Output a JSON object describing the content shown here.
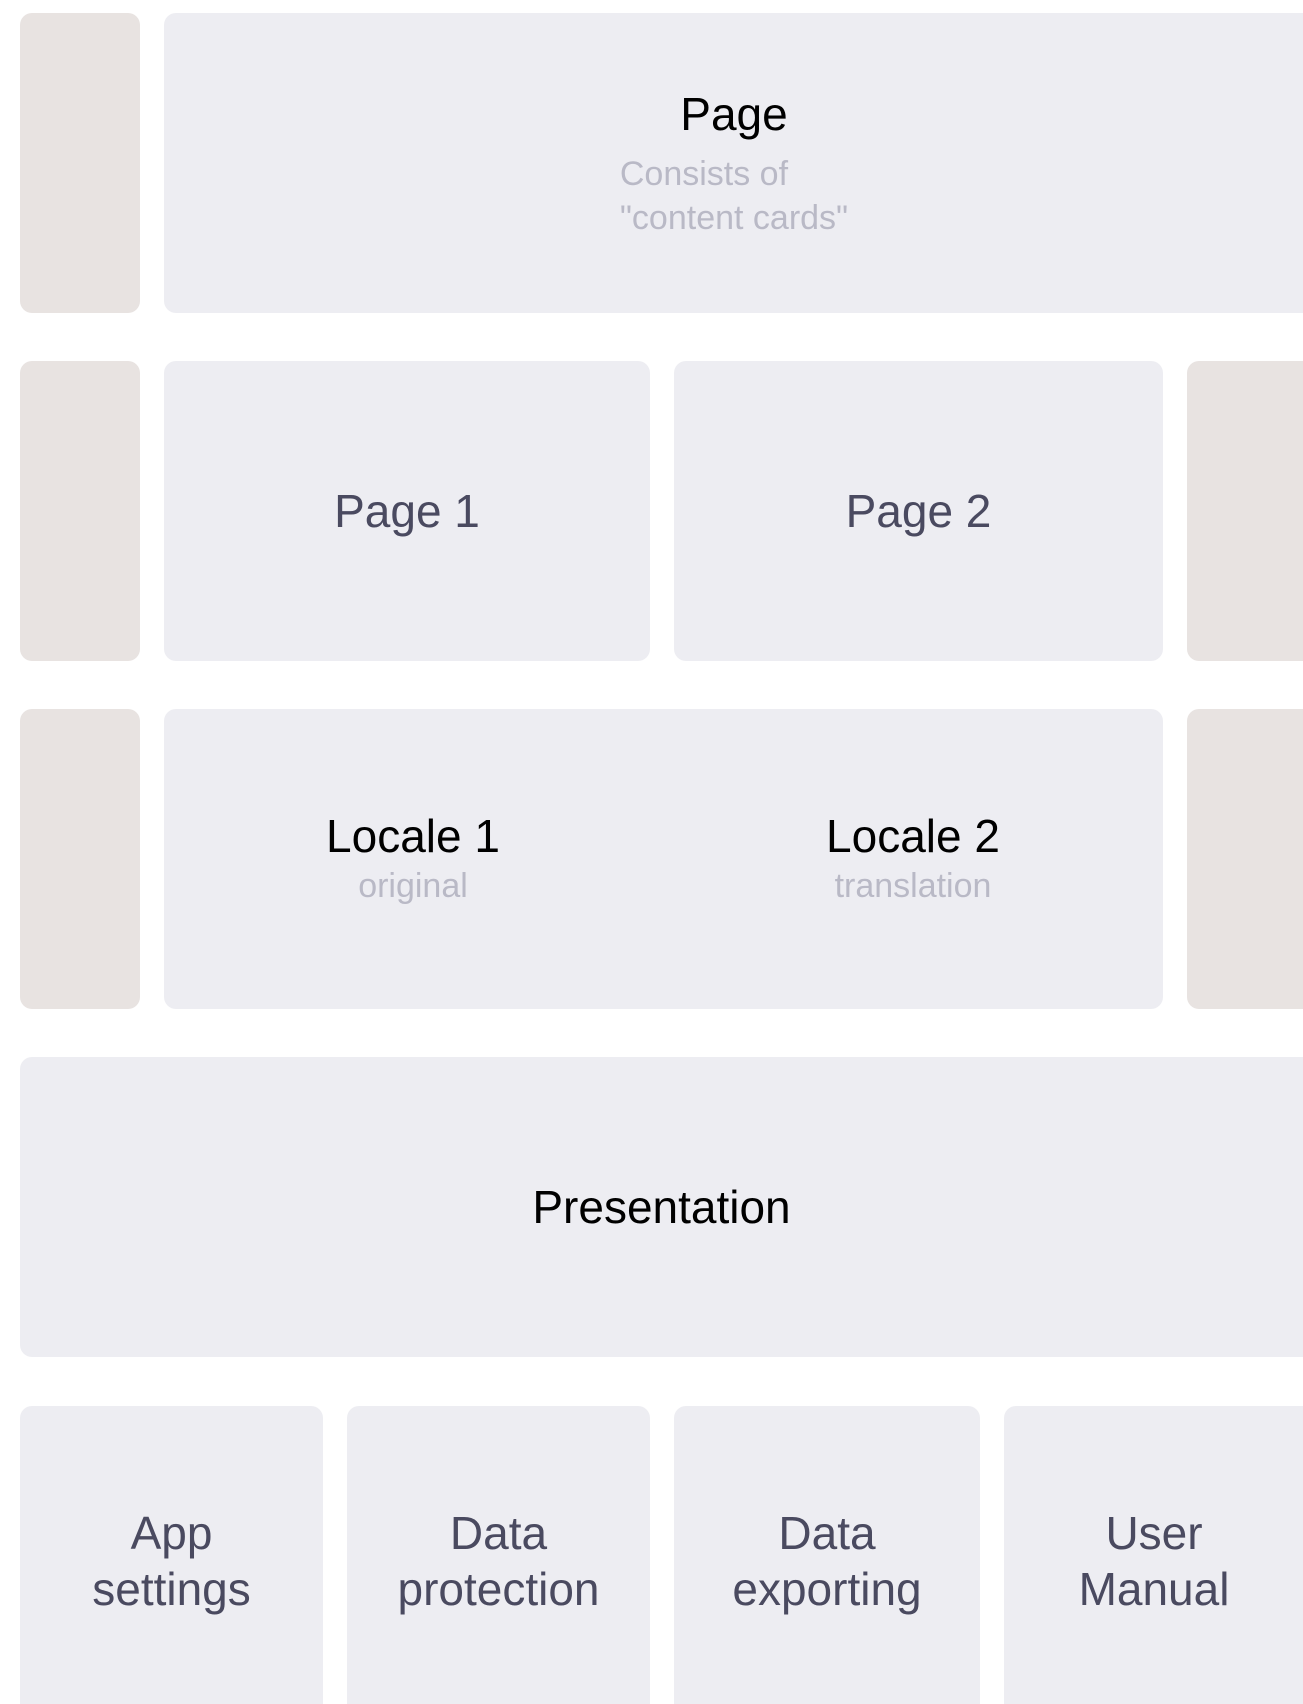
{
  "page_card": {
    "title": "Page",
    "subtitle": "Consists of\n\"content cards\""
  },
  "pages_row": {
    "page1": "Page 1",
    "page2": "Page 2"
  },
  "locales_row": {
    "locale1": {
      "title": "Locale 1",
      "subtitle": "original"
    },
    "locale2": {
      "title": "Locale 2",
      "subtitle": "translation"
    }
  },
  "presentation": {
    "title": "Presentation"
  },
  "bottom_cards": [
    {
      "title": "App\nsettings"
    },
    {
      "title": "Data\nprotection"
    },
    {
      "title": "Data\nexporting"
    },
    {
      "title": "User\nManual"
    }
  ],
  "colors": {
    "card_bg": "#ededf2",
    "side_bg": "#e8e3e1",
    "title_text": "#4a4a60",
    "subtitle_text": "#b9b9c6"
  }
}
